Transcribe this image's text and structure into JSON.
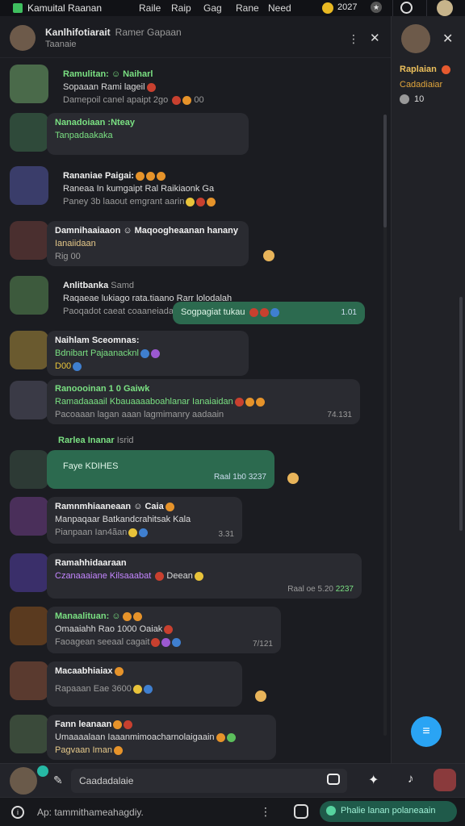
{
  "topbar": {
    "app_title": "Kamuital Raanan",
    "nav": [
      "Raile",
      "Raip",
      "Gag",
      "Rane",
      "Need"
    ],
    "coins": "2027"
  },
  "header": {
    "name": "Kanlhifotiarait",
    "sub": "Ramer Gapaan",
    "status": "Taanaie"
  },
  "messages": [
    {
      "name": "Ramulitan: ☺ Naiharl",
      "text": "Sopaaan Rami lageil",
      "meta": "Damepoil canel apaipt 2go",
      "meta_count": "00"
    },
    {
      "name": "Nanadoiaan :Nteay",
      "text": "Tanpadaakaka"
    },
    {
      "name": "Rananiae Paigai:",
      "text": "Raneaa In kumgaipt Ral Raikiaonk Ga",
      "meta": "Paney 3b laaout emgrant",
      "meta2": "aarin"
    },
    {
      "name": "Damnihaaiaaon ☺ Maqoogheaanan hanany",
      "text": "Ianaiidaan",
      "meta": "Rig 00"
    },
    {
      "name": "Anlitbanka",
      "name_sub": "Samd",
      "text": "Raqaeae lukiago rata.tiaano Rarr lolodalah",
      "meta": "Paoqadot caeat coaaneiadat",
      "bubble": "Sogpagiat tukau",
      "bubble_time": "1.01"
    },
    {
      "name": "Naihlam Sceomnas:",
      "text": "Bdnibart Pajaanacknl",
      "meta": "D00"
    },
    {
      "name": "Ranoooinan 1 0 Gaiwk",
      "text": "Ramadaaaail Kbauaaaaboahlanar Ianaiaidan",
      "meta": "Pacoaaan lagan aaan lagmimanry",
      "meta2": "aadaain",
      "time": "74.131"
    },
    {
      "name": "Rarlea Inanar",
      "name_sub": "Isrid"
    },
    {
      "bubble": "Faye KDIHES",
      "bubble_time": "Raal 1b0 3237"
    },
    {
      "name": "Ramnmhiaaneaan ☺ Caia",
      "text": "Manpaqaar Batkandcrahitsak Kala",
      "meta": "Pianpaan Ian4ãan",
      "time": "3.31"
    },
    {
      "name": "Ramahhidaaraan",
      "text": "Czanaaaiane Kilsaaabat",
      "text2": "Deean",
      "time": "Raal oe 5.20",
      "time_green": "2237"
    },
    {
      "name": "Manaalituan: ☺",
      "text": "Omaaiahh Rao 1000 Oaiak",
      "meta": "Faoagean seeaal cagait",
      "time": "7/121"
    },
    {
      "name": "Macaabhiaiax",
      "meta": "Rapaaan Eae 3600"
    },
    {
      "name": "Fann leanaan",
      "text": "Umaaaalaan Iaaanmimoacharnolaigaain",
      "meta": "Pagvaan Iman"
    }
  ],
  "side": {
    "name": "Raplaian",
    "sub": "Cadadiaiar",
    "count": "10"
  },
  "compose": {
    "placeholder": "Caadadalaie"
  },
  "footer": {
    "hint": "Ap: tammithameahagdiy.",
    "pill": "Phalie lanan polaneaain"
  }
}
